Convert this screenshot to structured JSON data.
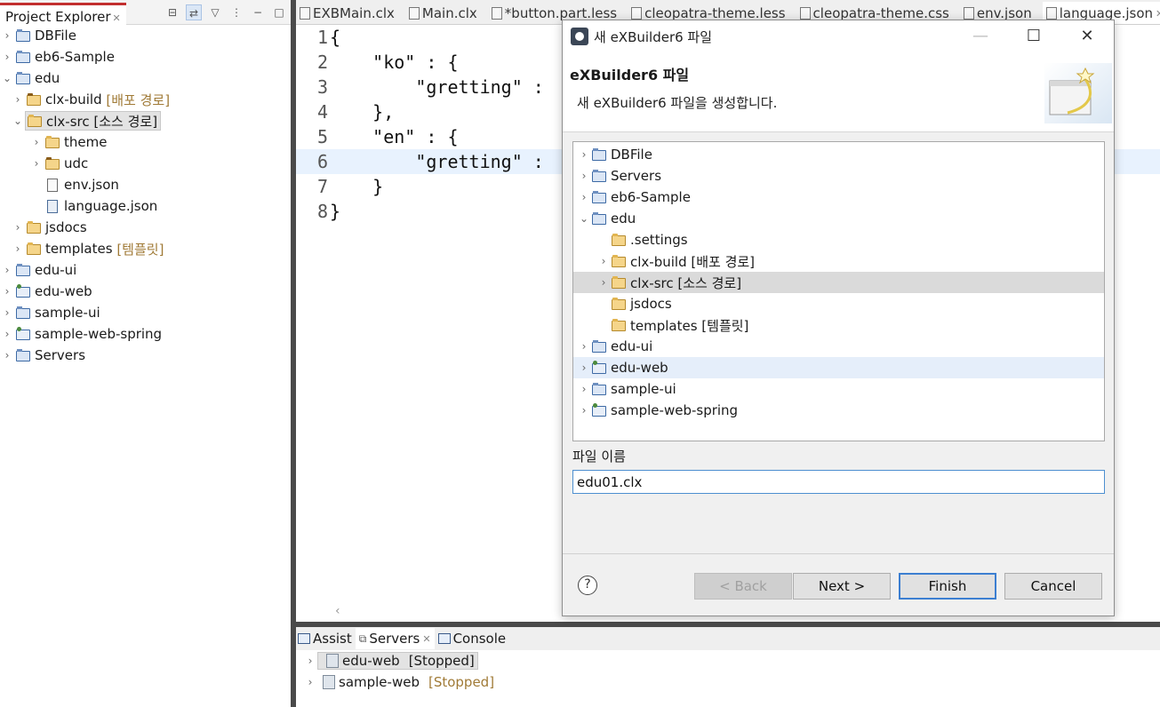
{
  "explorer": {
    "tab_label": "Project Explorer",
    "tree": [
      {
        "label": "DBFile",
        "icon": "project-icon"
      },
      {
        "label": "eb6-Sample",
        "icon": "project-icon"
      },
      {
        "label": "edu",
        "icon": "project-icon"
      },
      {
        "label": "clx-build",
        "decoration": "[배포 경로]",
        "icon": "source-folder-icon"
      },
      {
        "label": "clx-src [소스 경로]",
        "icon": "source-folder-icon"
      },
      {
        "label": "theme",
        "icon": "folder-icon"
      },
      {
        "label": "udc",
        "icon": "package-folder-icon"
      },
      {
        "label": "env.json",
        "icon": "file-icon"
      },
      {
        "label": "language.json",
        "icon": "json-file-icon"
      },
      {
        "label": "jsdocs",
        "icon": "folder-icon"
      },
      {
        "label": "templates",
        "decoration": "[템플릿]",
        "icon": "folder-icon"
      },
      {
        "label": "edu-ui",
        "icon": "project-icon"
      },
      {
        "label": "edu-web",
        "icon": "web-project-icon"
      },
      {
        "label": "sample-ui",
        "icon": "project-icon"
      },
      {
        "label": "sample-web-spring",
        "icon": "web-project-icon"
      },
      {
        "label": "Servers",
        "icon": "project-icon"
      }
    ]
  },
  "editor": {
    "tabs": [
      "EXBMain.clx",
      "Main.clx",
      "*button.part.less",
      "cleopatra-theme.less",
      "cleopatra-theme.css",
      "env.json",
      "language.json"
    ],
    "active_tab": "language.json",
    "lines": [
      {
        "n": "1",
        "text": "{"
      },
      {
        "n": "2",
        "text": "    \"ko\" : {"
      },
      {
        "n": "3",
        "text": "        \"gretting\" :"
      },
      {
        "n": "4",
        "text": "    },"
      },
      {
        "n": "5",
        "text": "    \"en\" : {"
      },
      {
        "n": "6",
        "text": "        \"gretting\" :"
      },
      {
        "n": "7",
        "text": "    }"
      },
      {
        "n": "8",
        "text": "}"
      }
    ]
  },
  "bottom_panel": {
    "tabs": [
      "Assist",
      "Servers",
      "Console"
    ],
    "servers": [
      {
        "name": "edu-web",
        "status": "[Stopped]"
      },
      {
        "name": "sample-web",
        "status": "[Stopped]"
      }
    ]
  },
  "dialog": {
    "window_title": "새 eXBuilder6 파일",
    "heading": "eXBuilder6 파일",
    "description": "새 eXBuilder6 파일을 생성합니다.",
    "tree": [
      {
        "label": "DBFile",
        "icon": "project-icon"
      },
      {
        "label": "Servers",
        "icon": "project-icon"
      },
      {
        "label": "eb6-Sample",
        "icon": "project-icon"
      },
      {
        "label": "edu",
        "icon": "project-icon"
      },
      {
        "label": ".settings",
        "icon": "folder-icon"
      },
      {
        "label": "clx-build [배포 경로]",
        "icon": "folder-icon"
      },
      {
        "label": "clx-src [소스 경로]",
        "icon": "folder-icon"
      },
      {
        "label": "jsdocs",
        "icon": "folder-icon"
      },
      {
        "label": "templates [템플릿]",
        "icon": "folder-icon"
      },
      {
        "label": "edu-ui",
        "icon": "project-icon"
      },
      {
        "label": "edu-web",
        "icon": "web-project-icon"
      },
      {
        "label": "sample-ui",
        "icon": "project-icon"
      },
      {
        "label": "sample-web-spring",
        "icon": "web-project-icon"
      }
    ],
    "file_name_label": "파일 이름",
    "file_name_value": "edu01.clx",
    "buttons": {
      "back": "< Back",
      "next": "Next >",
      "finish": "Finish",
      "cancel": "Cancel"
    },
    "help_glyph": "?"
  },
  "colors": {
    "selection": "#e3e3e3",
    "accent_border": "#3c7fd1",
    "decoration": "#a07a36"
  }
}
